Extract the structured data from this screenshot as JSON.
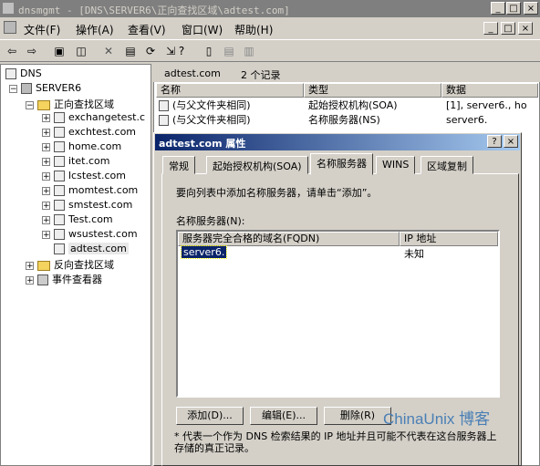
{
  "window": {
    "title": "dnsmgmt - [DNS\\SERVER6\\正向查找区域\\adtest.com]",
    "controls": [
      "_",
      "□",
      "×"
    ]
  },
  "menu": [
    "文件(F)",
    "操作(A)",
    "查看(V)",
    "窗口(W)",
    "帮助(H)"
  ],
  "mdi_controls": [
    "_",
    "□",
    "×"
  ],
  "toolbar": [
    "back-icon",
    "forward-icon",
    "up-icon",
    "show-tree-icon",
    "delete-icon",
    "properties-icon",
    "refresh-icon",
    "export-icon",
    "help-icon",
    "server-icon",
    "zone-icon",
    "record-icon"
  ],
  "tree": {
    "root": "DNS",
    "server": "SERVER6",
    "forward_zone": "正向查找区域",
    "zones": [
      "exchangetest.c",
      "exchtest.com",
      "home.com",
      "itet.com",
      "lcstest.com",
      "momtest.com",
      "smstest.com",
      "Test.com",
      "wsustest.com",
      "adtest.com"
    ],
    "reverse_zone": "反向查找区域",
    "event_viewer": "事件查看器"
  },
  "right": {
    "zone_name": "adtest.com",
    "record_count": "2 个记录",
    "columns": [
      "名称",
      "类型",
      "数据"
    ],
    "rows": [
      {
        "name": "(与父文件夹相同)",
        "type": "起始授权机构(SOA)",
        "data": "[1], server6., ho"
      },
      {
        "name": "(与父文件夹相同)",
        "type": "名称服务器(NS)",
        "data": "server6."
      }
    ]
  },
  "dialog": {
    "title": "adtest.com 属性",
    "title_buttons": [
      "?",
      "×"
    ],
    "tabs": [
      "常规",
      "起始授权机构(SOA)",
      "名称服务器",
      "WINS",
      "区域复制"
    ],
    "active_tab": "名称服务器",
    "instruction": "要向列表中添加名称服务器，请单击“添加”。",
    "list_label": "名称服务器(N):",
    "list_columns": [
      "服务器完全合格的域名(FQDN)",
      "IP 地址"
    ],
    "list_rows": [
      {
        "fqdn": "server6.",
        "ip": "未知"
      }
    ],
    "buttons": {
      "add": "添加(D)...",
      "edit": "编辑(E)...",
      "remove": "删除(R)"
    },
    "note": "* 代表一个作为 DNS 检索结果的 IP 地址并且可能不代表在这台服务器上存储的真正记录。"
  },
  "watermark": "ChinaUnix 博客"
}
